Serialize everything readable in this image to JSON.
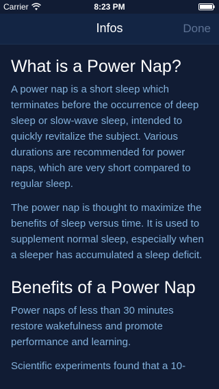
{
  "status_bar": {
    "carrier": "Carrier",
    "time": "8:23 PM",
    "wifi_icon": "wifi-icon",
    "battery_icon": "battery-full-icon"
  },
  "nav": {
    "title": "Infos",
    "done_label": "Done"
  },
  "sections": [
    {
      "heading": "What is a Power Nap?",
      "paragraphs": [
        "A power nap is a short sleep which terminates before the occurrence of deep sleep or slow-wave sleep, intended to quickly revitalize the subject. Various durations are recommended for power naps, which are very short compared to regular sleep.",
        "The power nap is thought to maximize the benefits of sleep versus time. It is used to supplement normal sleep, especially when a sleeper has accumulated a sleep deficit."
      ]
    },
    {
      "heading": "Benefits of a Power Nap",
      "paragraphs": [
        "Power naps of less than 30 minutes restore wakefulness and promote performance and learning.",
        "Scientific experiments found that a 10-"
      ]
    }
  ],
  "colors": {
    "background": "#111c34",
    "nav_background": "#132544",
    "heading": "#ffffff",
    "body_text": "#83b1db",
    "done_disabled": "#5d7294"
  }
}
